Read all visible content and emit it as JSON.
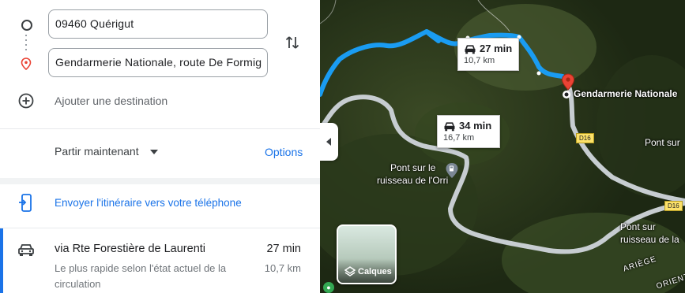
{
  "directions": {
    "origin_value": "09460 Quérigut",
    "destination_value": "Gendarmerie Nationale, route De Formig",
    "add_destination_label": "Ajouter une destination",
    "depart_label": "Partir maintenant",
    "options_label": "Options",
    "send_to_phone_label": "Envoyer l'itinéraire vers votre téléphone",
    "route": {
      "name": "via Rte Forestière de Laurenti",
      "duration": "27 min",
      "subtitle": "Le plus rapide selon l'état actuel de la circulation",
      "distance": "10,7 km"
    }
  },
  "map": {
    "bubble_primary": {
      "time": "27 min",
      "distance": "10,7 km"
    },
    "bubble_alt": {
      "time": "34 min",
      "distance": "16,7 km"
    },
    "destination_label": "Gendarmerie Nationale",
    "poi_label_line1": "Pont sur le",
    "poi_label_line2": "ruisseau de l'Orri",
    "right_label_line1": "Pont sur",
    "right_label_line2": "ruisseau de la",
    "road_d16_a": "D16",
    "road_d16_b": "D16",
    "region_label": "ARIÈGE",
    "region_label_2": "ORIENT",
    "layers_label": "Calques"
  },
  "colors": {
    "primary_route": "#1a9cf2",
    "alt_route": "#c7cdd1",
    "accent": "#1a73e8",
    "pin": "#ea4335"
  },
  "icons": [
    "circle-icon",
    "destination-pin-icon",
    "swap-icon",
    "add-circle-icon",
    "dropdown-arrow-icon",
    "phone-send-icon",
    "car-icon",
    "collapse-arrow-icon",
    "layers-icon",
    "gas-station-icon"
  ]
}
